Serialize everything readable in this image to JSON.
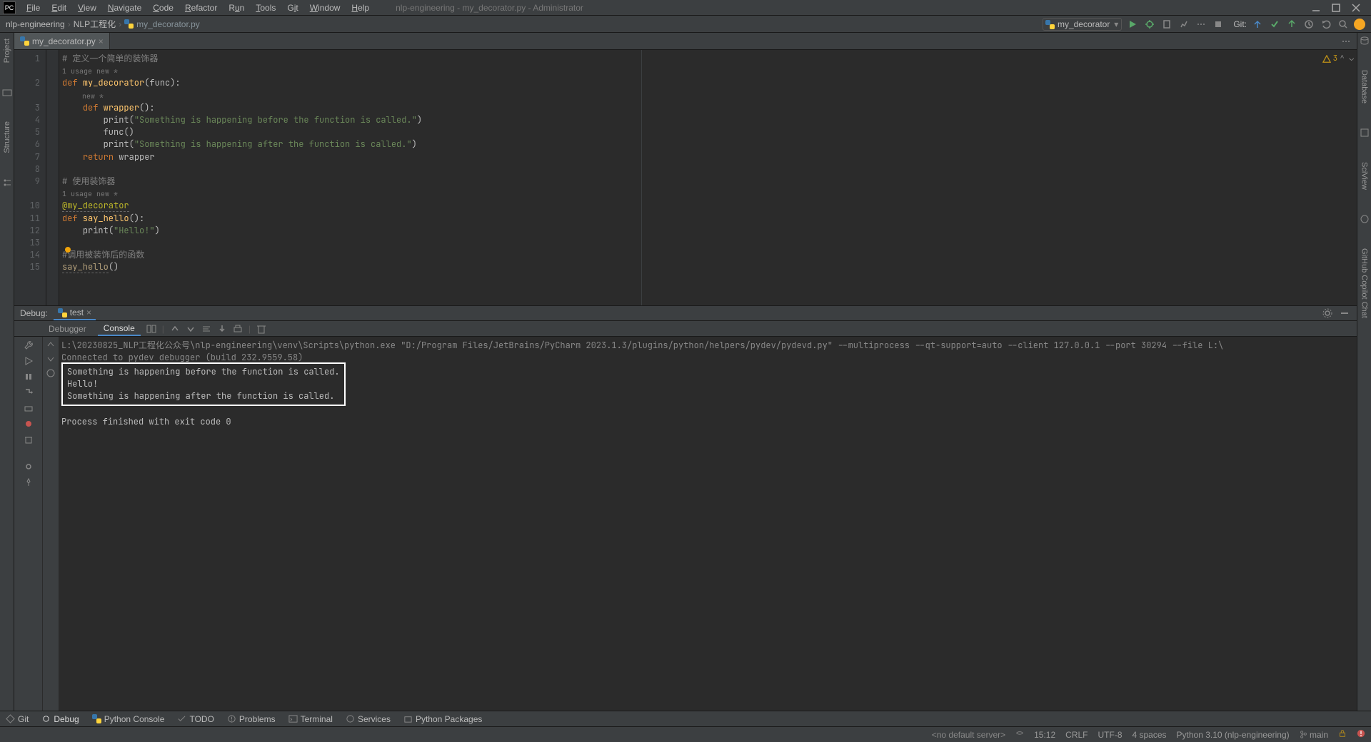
{
  "title": "nlp-engineering - my_decorator.py - Administrator",
  "menu": [
    "File",
    "Edit",
    "View",
    "Navigate",
    "Code",
    "Refactor",
    "Run",
    "Tools",
    "Git",
    "Window",
    "Help"
  ],
  "breadcrumb": {
    "p1": "nlp-engineering",
    "p2": "NLP工程化",
    "p3": "my_decorator.py"
  },
  "run_config": "my_decorator",
  "git_label": "Git:",
  "file_tab": "my_decorator.py",
  "inspection_count": "3",
  "code": {
    "comment1": "# 定义一个简单的装饰器",
    "usage1": "1 usage   new *",
    "def1": "def",
    "fn1": " my_decorator",
    "sig1": "(func):",
    "usage2": "new *",
    "def2": "def",
    "fn2": " wrapper",
    "sig2": "():",
    "print1a": "print(",
    "str1": "\"Something is happening before the function is called.\"",
    "print1b": ")",
    "func_call": "func()",
    "print2a": "print(",
    "str2": "\"Something is happening after the function is called.\"",
    "print2b": ")",
    "ret": "return",
    "retv": " wrapper",
    "comment2": "# 使用装饰器",
    "usage3": "1 usage   new *",
    "decor": "@my_decorator",
    "def3": "def",
    "fn3": " say_hello",
    "sig3": "():",
    "print3a": "print(",
    "str3": "\"Hello!\"",
    "print3b": ")",
    "comment3": "#调用被装饰后的函数",
    "call": "say_hello",
    "callp": "()"
  },
  "line_nums": [
    "1",
    "2",
    "3",
    "4",
    "5",
    "6",
    "7",
    "8",
    "9",
    "10",
    "11",
    "12",
    "13",
    "14",
    "15"
  ],
  "debug": {
    "label": "Debug:",
    "tab": "test",
    "subtab1": "Debugger",
    "subtab2": "Console"
  },
  "console": {
    "exe": "L:\\20230825_NLP工程化公众号\\nlp-engineering\\venv\\Scripts\\python.exe \"D:/Program Files/JetBrains/PyCharm 2023.1.3/plugins/python/helpers/pydev/pydevd.py\" --multiprocess --qt-support=auto --client 127.0.0.1 --port 30294 --file L:\\",
    "conn": "Connected to pydev debugger (build 232.9559.58)",
    "l1": "Something is happening before the function is called.",
    "l2": "Hello!",
    "l3": "Something is happening after the function is called.",
    "exit": "Process finished with exit code 0"
  },
  "bottom_tools": {
    "git": "Git",
    "debug": "Debug",
    "pyconsole": "Python Console",
    "todo": "TODO",
    "problems": "Problems",
    "terminal": "Terminal",
    "services": "Services",
    "pypkg": "Python Packages"
  },
  "status": {
    "server": "<no default server>",
    "pos": "15:12",
    "le": "CRLF",
    "enc": "UTF-8",
    "indent": "4 spaces",
    "interp": "Python 3.10 (nlp-engineering)",
    "branch": "main"
  },
  "right_tabs": {
    "db": "Database",
    "sci": "SciView",
    "gh": "GitHub Copilot Chat"
  },
  "left_tabs": {
    "project": "Project",
    "structure": "Structure"
  }
}
